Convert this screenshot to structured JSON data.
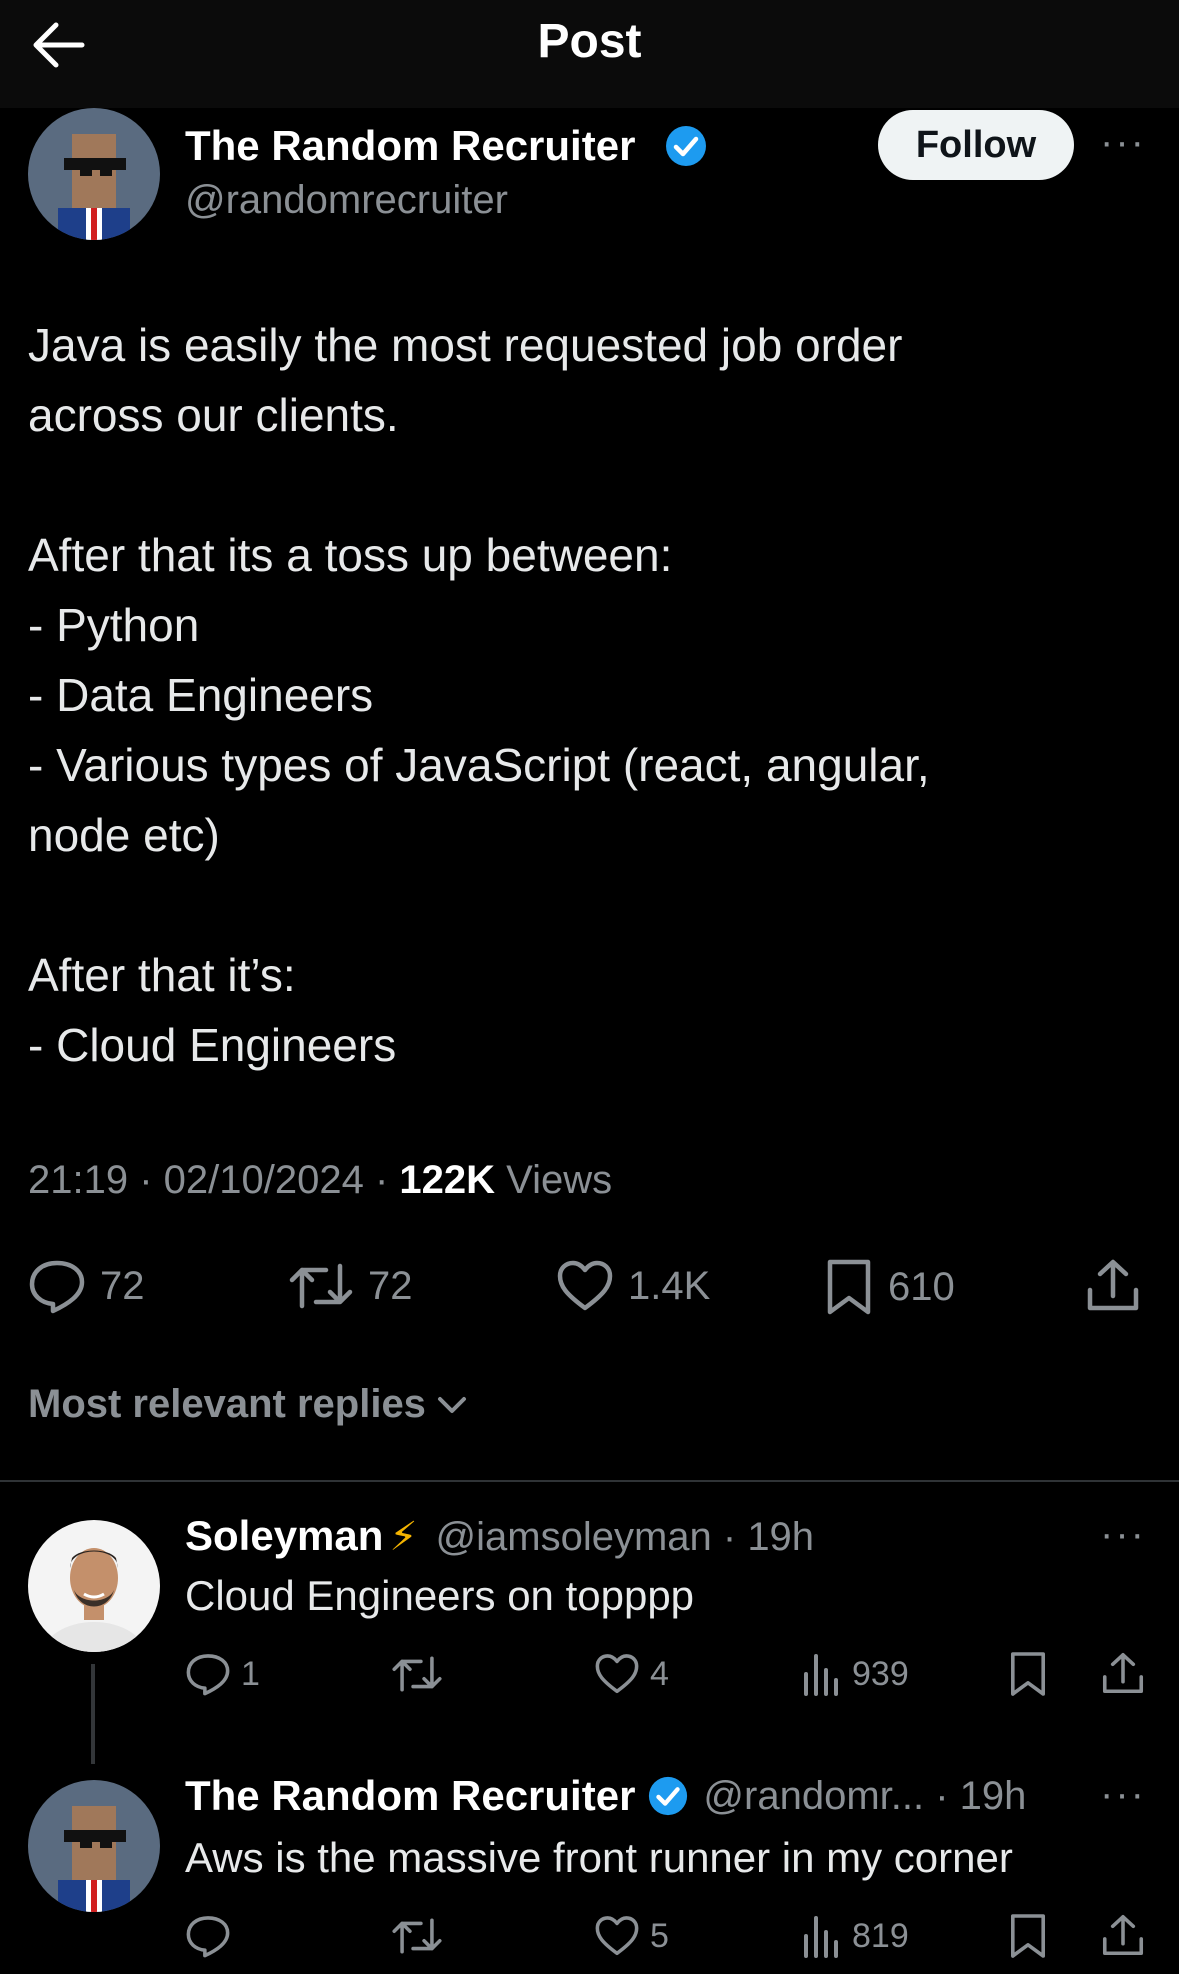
{
  "header": {
    "title": "Post"
  },
  "post": {
    "author_name": "The Random Recruiter",
    "author_handle": "@randomrecruiter",
    "follow_label": "Follow",
    "more_label": "···",
    "text": "Java is easily the most requested job order\nacross our clients.\n\nAfter that its a toss up between:\n- Python\n- Data Engineers\n- Various types of JavaScript (react, angular,\nnode etc)\n\nAfter that it’s:\n- Cloud Engineers",
    "time": "21:19 · 02/10/2024 · ",
    "views_count": "122K",
    "views_label": " Views",
    "stats": {
      "replies": "72",
      "reposts": "72",
      "likes": "1.4K",
      "bookmarks": "610"
    }
  },
  "replies_section": {
    "label": "Most relevant replies"
  },
  "replies": [
    {
      "author_name": "Soleyman",
      "author_badge": "⚡",
      "handle_time": "@iamsoleyman · 19h",
      "text": "Cloud Engineers on topppp",
      "replies": "1",
      "likes": "4",
      "views": "939",
      "more_label": "···"
    },
    {
      "author_name": "The Random Recruiter",
      "handle_time": "@randomr... · 19h",
      "text": "Aws is the massive front runner in my corner",
      "likes": "5",
      "views": "819",
      "more_label": "···"
    }
  ],
  "colors": {
    "verified": "#1d9bf0",
    "muted": "#8b9095",
    "background": "#000000"
  },
  "icons": [
    "back-arrow-icon",
    "verified-icon",
    "reply-icon",
    "repost-icon",
    "like-icon",
    "bookmark-icon",
    "share-icon",
    "views-icon",
    "chevron-down-icon"
  ]
}
